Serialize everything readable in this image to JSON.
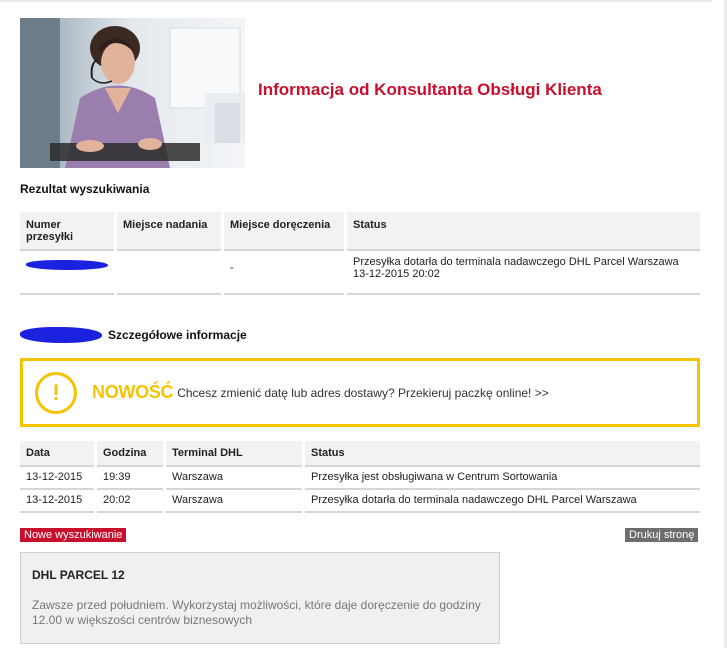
{
  "header": {
    "title": "Informacja od Konsultanta Obsługi Klienta"
  },
  "result": {
    "heading": "Rezultat wyszukiwania",
    "columns": [
      "Numer przesyłki",
      "Miejsce nadania",
      "Miejsce doręczenia",
      "Status"
    ],
    "row": {
      "tracking_number": "",
      "origin": "",
      "destination": "-",
      "status_line1": "Przesyłka dotarła do terminala nadawczego DHL Parcel Warszawa",
      "status_line2": "13-12-2015 20:02"
    }
  },
  "details": {
    "heading": "Szczegółowe informacje"
  },
  "promo": {
    "icon_glyph": "!",
    "strong": "NOWOŚĆ",
    "text": "Chcesz zmienić datę lub adres dostawy? Przekieruj paczkę online! >>",
    "color": "#f5c400"
  },
  "events": {
    "columns": [
      "Data",
      "Godzina",
      "Terminal DHL",
      "Status"
    ],
    "rows": [
      {
        "date": "13-12-2015",
        "time": "19:39",
        "terminal": "Warszawa",
        "status": "Przesyłka jest obsługiwana w Centrum Sortowania"
      },
      {
        "date": "13-12-2015",
        "time": "20:02",
        "terminal": "Warszawa",
        "status": "Przesyłka dotarła do terminala nadawczego DHL Parcel Warszawa"
      }
    ]
  },
  "buttons": {
    "new_search": "Nowe wyszukiwanie",
    "print": "Drukuj stronę"
  },
  "parcel12": {
    "title": "DHL PARCEL 12",
    "text": "Zawsze przed południem. Wykorzystaj możliwości, które daje doręczenie do godziny 12.00 w większości centrów biznesowych"
  },
  "colors": {
    "brand_red": "#c8102e",
    "accent_yellow": "#f5c400",
    "redaction_blue": "#1a22e0"
  }
}
